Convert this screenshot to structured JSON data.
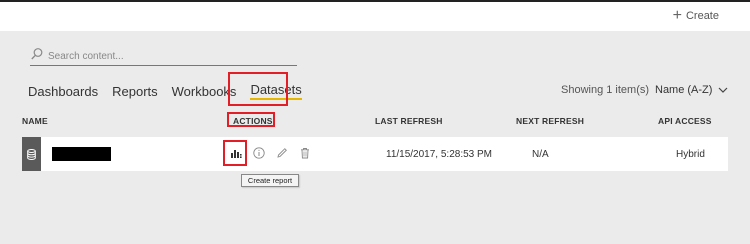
{
  "header": {
    "create_label": "Create"
  },
  "search": {
    "placeholder": "Search content..."
  },
  "tabs": [
    {
      "label": "Dashboards",
      "active": false
    },
    {
      "label": "Reports",
      "active": false
    },
    {
      "label": "Workbooks",
      "active": false
    },
    {
      "label": "Datasets",
      "active": true
    }
  ],
  "status": {
    "showing": "Showing 1 item(s)",
    "sort": "Name (A-Z)"
  },
  "table": {
    "columns": [
      "NAME",
      "ACTIONS",
      "LAST REFRESH",
      "NEXT REFRESH",
      "API ACCESS"
    ],
    "rows": [
      {
        "last_refresh": "11/15/2017, 5:28:53 PM",
        "next_refresh": "N/A",
        "api_access": "Hybrid"
      }
    ]
  },
  "tooltip": {
    "text": "Create report"
  },
  "colors": {
    "highlight": "#e21e26",
    "active_tab_underline": "#e5b700",
    "row_icon_bg": "#5a5a5a"
  }
}
